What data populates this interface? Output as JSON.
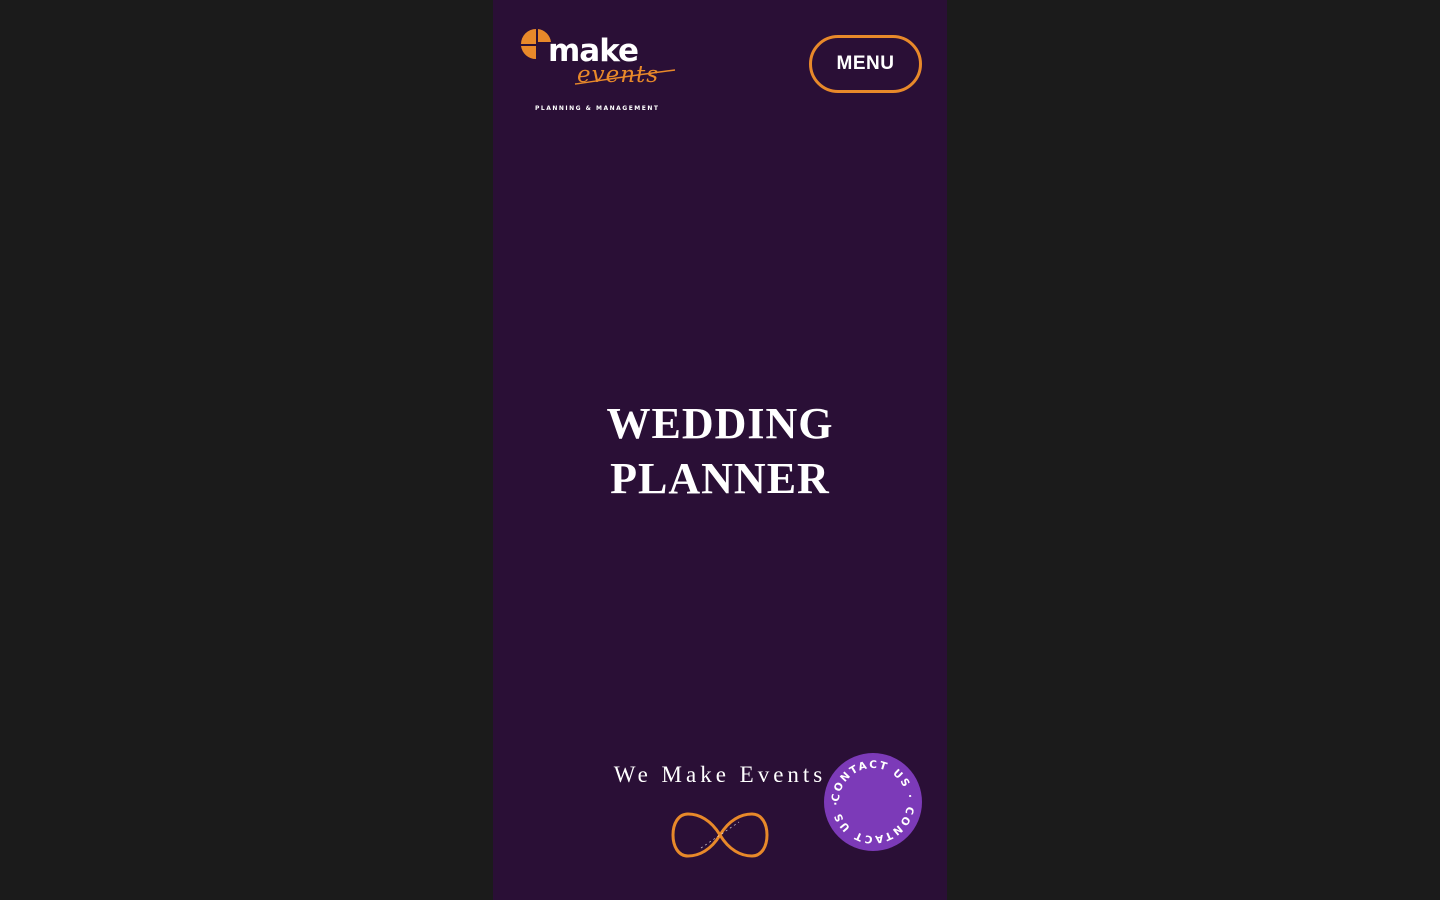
{
  "brand": {
    "name": "make",
    "script": "events",
    "tagline": "PLANNING & MANAGEMENT"
  },
  "header": {
    "menu_label": "MENU"
  },
  "hero": {
    "title_line1": "WEDDING",
    "title_line2": "PLANNER",
    "tagline": "We Make Events"
  },
  "contact_badge": {
    "text": "CONTACT US · CONTACT US · "
  },
  "icons": {
    "logo": "make-events-logo-mark",
    "infinity": "infinity-icon"
  },
  "colors": {
    "page_background": "#2a0f36",
    "outer_background": "#1b1b1b",
    "accent_orange": "#e8892a",
    "badge_purple": "#7c3ab8",
    "text_white": "#ffffff"
  }
}
